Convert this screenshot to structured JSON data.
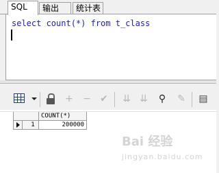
{
  "tabs": [
    {
      "label": "SQL",
      "active": true
    },
    {
      "label": "输出",
      "active": false
    },
    {
      "label": "统计表",
      "active": false
    }
  ],
  "editor": {
    "sql_text": "select count(*) from t_class",
    "text_color": "#1a1acc"
  },
  "toolbar": {
    "icons": [
      "grid-view-icon",
      "dropdown-arrow-icon",
      "lock-icon",
      "add-record-icon",
      "delete-record-icon",
      "post-changes-icon",
      "next-page-icon",
      "last-page-icon",
      "find-icon",
      "clear-icon",
      "export-icon"
    ]
  },
  "results": {
    "columns": [
      "COUNT(*)"
    ],
    "rows": [
      {
        "num": "1",
        "values": [
          "200000"
        ]
      }
    ]
  },
  "watermark": {
    "line1": "Bai 经验",
    "line2": "jingyan.baidu.com"
  }
}
